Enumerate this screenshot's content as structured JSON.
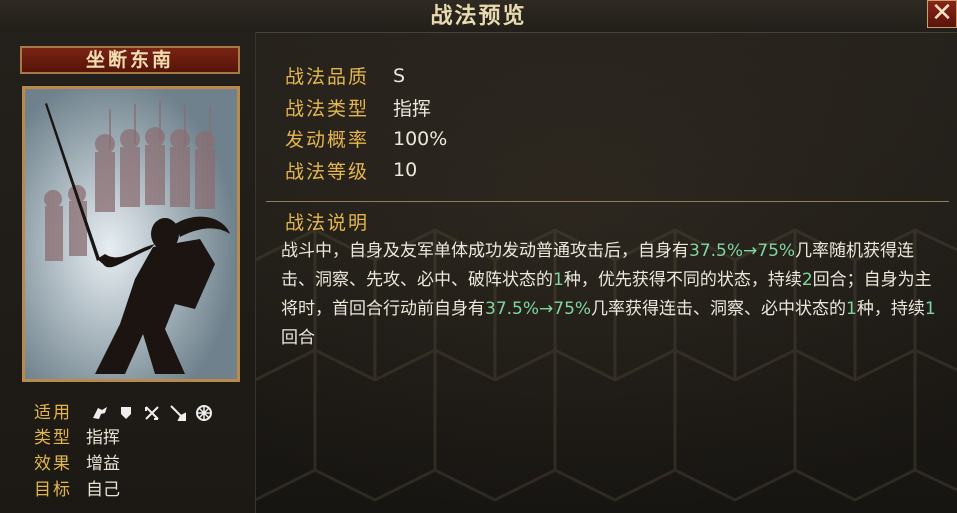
{
  "header": {
    "title": "战法预览",
    "close_label": "✕"
  },
  "skill": {
    "name": "坐断东南"
  },
  "info": {
    "apply_label": "适用",
    "type_label": "类型",
    "type_value": "指挥",
    "effect_label": "效果",
    "effect_value": "增益",
    "target_label": "目标",
    "target_value": "自己",
    "troop_icons": [
      "cavalry-icon",
      "shield-icon",
      "archer-icon",
      "spear-icon",
      "siege-icon"
    ]
  },
  "attributes": [
    {
      "label": "战法品质",
      "value": "S"
    },
    {
      "label": "战法类型",
      "value": "指挥"
    },
    {
      "label": "发动概率",
      "value": "100%"
    },
    {
      "label": "战法等级",
      "value": "10"
    }
  ],
  "description": {
    "heading": "战法说明",
    "p1": "战斗中，自身及友军单体成功发动普通攻击后，自身有",
    "h1": "37.5%→75%",
    "p2": "几率随机获得连击、洞察、先攻、必中、破阵状态的",
    "h2": "1",
    "p3": "种，优先获得不同的状态，持续",
    "h3": "2",
    "p4": "回合；自身为主将时，首回合行动前自身有",
    "h4": "37.5%→75%",
    "p5": "几率获得连击、洞察、必中状态的",
    "h5": "1",
    "p6": "种，持续",
    "h6": "1",
    "p7": "回合"
  },
  "colors": {
    "gold": "#e3b64e",
    "highlight": "#7fd6a0",
    "frame": "#b88a4b"
  }
}
